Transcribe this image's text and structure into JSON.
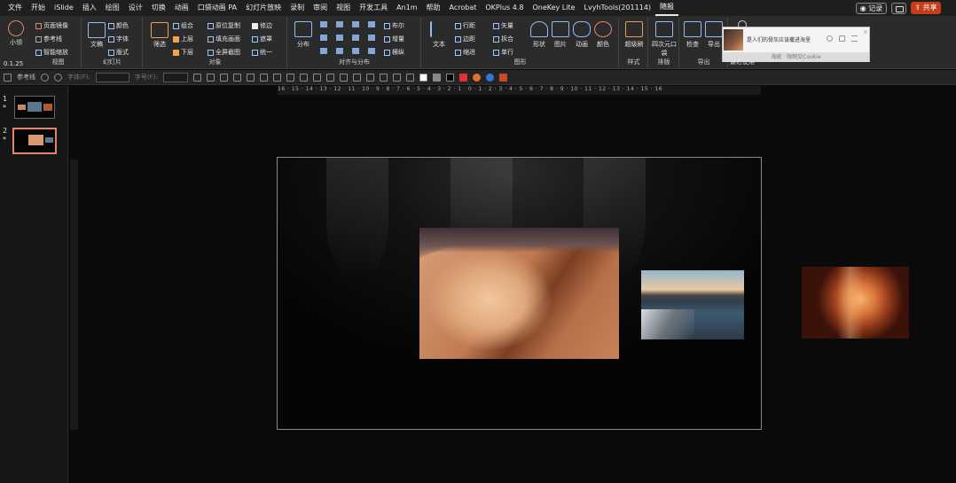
{
  "menu": {
    "tabs": [
      "文件",
      "开始",
      "iSlide",
      "插入",
      "绘图",
      "设计",
      "切换",
      "动画",
      "口袋动画 PA",
      "幻灯片放映",
      "录制",
      "审阅",
      "视图",
      "开发工具",
      "An1m",
      "帮助",
      "Acrobat",
      "OKPlus 4.8",
      "OneKey Lite",
      "LvyhTools(201114)",
      "随报"
    ],
    "record": "◉ 记录",
    "share": "⇪ 共享"
  },
  "ribbon": {
    "view_group": {
      "label": "视图",
      "small": "小领",
      "zoom": "0.1.25",
      "items": [
        "页面镜像",
        "参考线",
        "智能缩放"
      ]
    },
    "slide_group": {
      "label": "幻灯片",
      "doc": "文稿",
      "items": [
        "颜色",
        "字体",
        "版式"
      ]
    },
    "object_group": {
      "label": "对象",
      "filter": "筛选",
      "items": [
        "组合",
        "上层",
        "下层",
        "原位复制",
        "填充画面",
        "全屏截图",
        "修边",
        "遮罩",
        "统一"
      ]
    },
    "align_group": {
      "label": "对齐与分布",
      "distribute": "分布",
      "items": [
        "布尔",
        "增量",
        "横纵"
      ]
    },
    "shape_group": {
      "label": "图形",
      "text": "文本",
      "items": [
        "行距",
        "边距",
        "缩进",
        "矢量",
        "拆合",
        "单行"
      ],
      "buttons": [
        "形状",
        "图片",
        "动画",
        "颜色"
      ]
    },
    "style_group": {
      "label": "样式",
      "btn": "超级刷"
    },
    "layout_group": {
      "label": "排版",
      "btn": "四次元口袋"
    },
    "export_group": {
      "label": "导出",
      "buttons": [
        "检查",
        "导出"
      ]
    },
    "recent_group": {
      "label": "最近使用"
    }
  },
  "qat": {
    "guide": "参考线",
    "font_label": "字体(F):",
    "size_label": "字号(F):"
  },
  "notify": {
    "text": "是人们的骨灰应该撒进海里",
    "foot": "海底 · 限制交Cookie"
  },
  "thumbs": [
    {
      "num": "1",
      "mark": "*"
    },
    {
      "num": "2",
      "mark": "*"
    }
  ],
  "ruler_h": "16 · 15 · 14 · 13 · 12 · 11 · 10 · 9 · 8 · 7 · 6 · 5 · 4 · 3 · 2 · 1 · 0 · 1 · 2 · 3 · 4 · 5 · 6 · 7 · 8 · 9 · 10 · 11 · 12 · 13 · 14 · 15 · 16"
}
